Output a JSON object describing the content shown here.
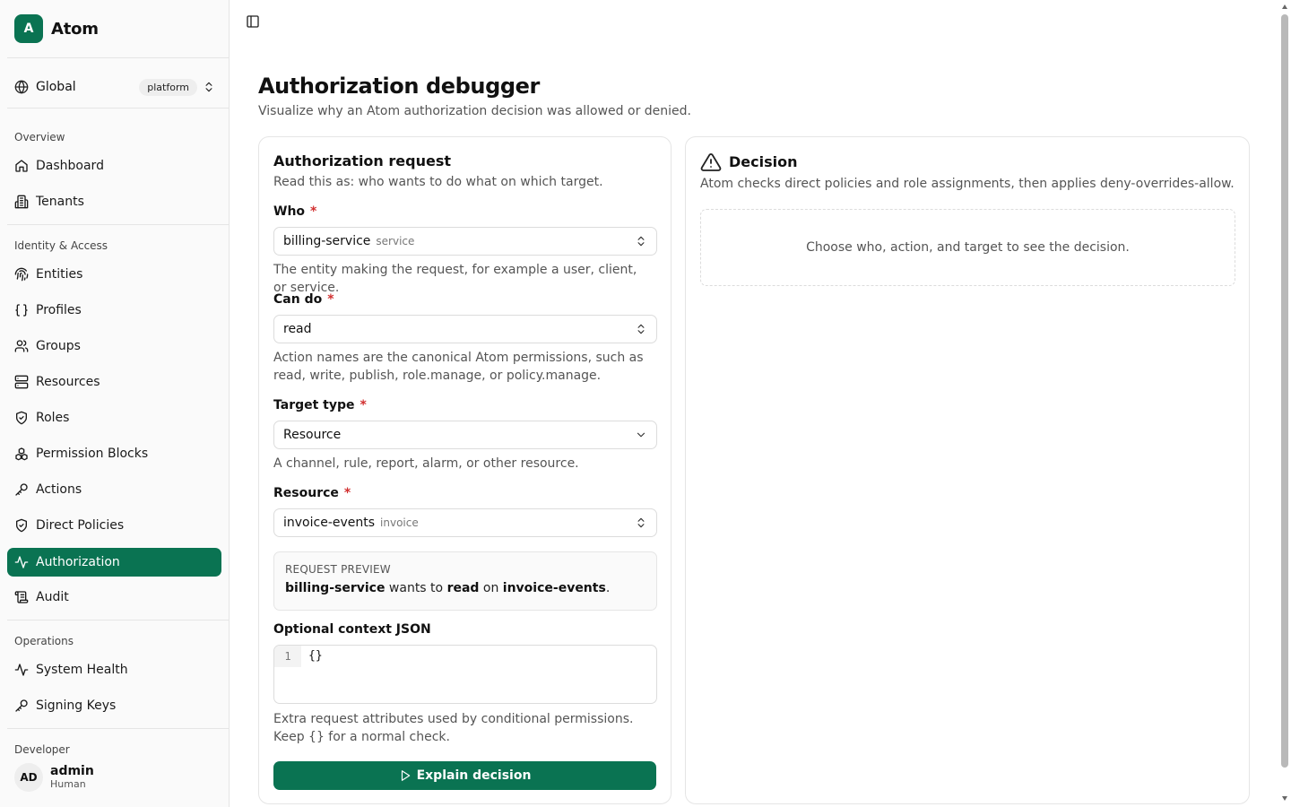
{
  "brand": {
    "initial": "A",
    "name": "Atom"
  },
  "scope": {
    "label": "Global",
    "badge": "platform"
  },
  "nav": {
    "overview_heading": "Overview",
    "identity_heading": "Identity & Access",
    "operations_heading": "Operations",
    "developer_heading": "Developer",
    "items": {
      "dashboard": "Dashboard",
      "tenants": "Tenants",
      "entities": "Entities",
      "profiles": "Profiles",
      "groups": "Groups",
      "resources": "Resources",
      "roles": "Roles",
      "permission_blocks": "Permission Blocks",
      "actions": "Actions",
      "direct_policies": "Direct Policies",
      "authorization": "Authorization",
      "audit": "Audit",
      "system_health": "System Health",
      "signing_keys": "Signing Keys"
    }
  },
  "user": {
    "initials": "AD",
    "name": "admin",
    "role": "Human"
  },
  "page": {
    "title": "Authorization debugger",
    "subtitle": "Visualize why an Atom authorization decision was allowed or denied."
  },
  "request_card": {
    "title": "Authorization request",
    "description": "Read this as: who wants to do what on which target.",
    "who": {
      "label": "Who",
      "value": "billing-service",
      "tag": "service",
      "help": "The entity making the request, for example a user, client, or service."
    },
    "can_do": {
      "label": "Can do",
      "value": "read",
      "help": "Action names are the canonical Atom permissions, such as read, write, publish, role.manage, or policy.manage."
    },
    "target_type": {
      "label": "Target type",
      "value": "Resource",
      "help": "A channel, rule, report, alarm, or other resource."
    },
    "resource": {
      "label": "Resource",
      "value": "invoice-events",
      "tag": "invoice"
    },
    "preview": {
      "heading": "REQUEST PREVIEW",
      "who": "billing-service",
      "text1": " wants to ",
      "action": "read",
      "text2": " on ",
      "target": "invoice-events",
      "end": "."
    },
    "context": {
      "label": "Optional context JSON",
      "line_number": "1",
      "code": "{}",
      "help": "Extra request attributes used by conditional permissions. Keep {} for a normal check."
    },
    "submit_label": "Explain decision"
  },
  "decision_card": {
    "title": "Decision",
    "description": "Atom checks direct policies and role assignments, then applies deny-overrides-allow.",
    "empty_text": "Choose who, action, and target to see the decision."
  }
}
